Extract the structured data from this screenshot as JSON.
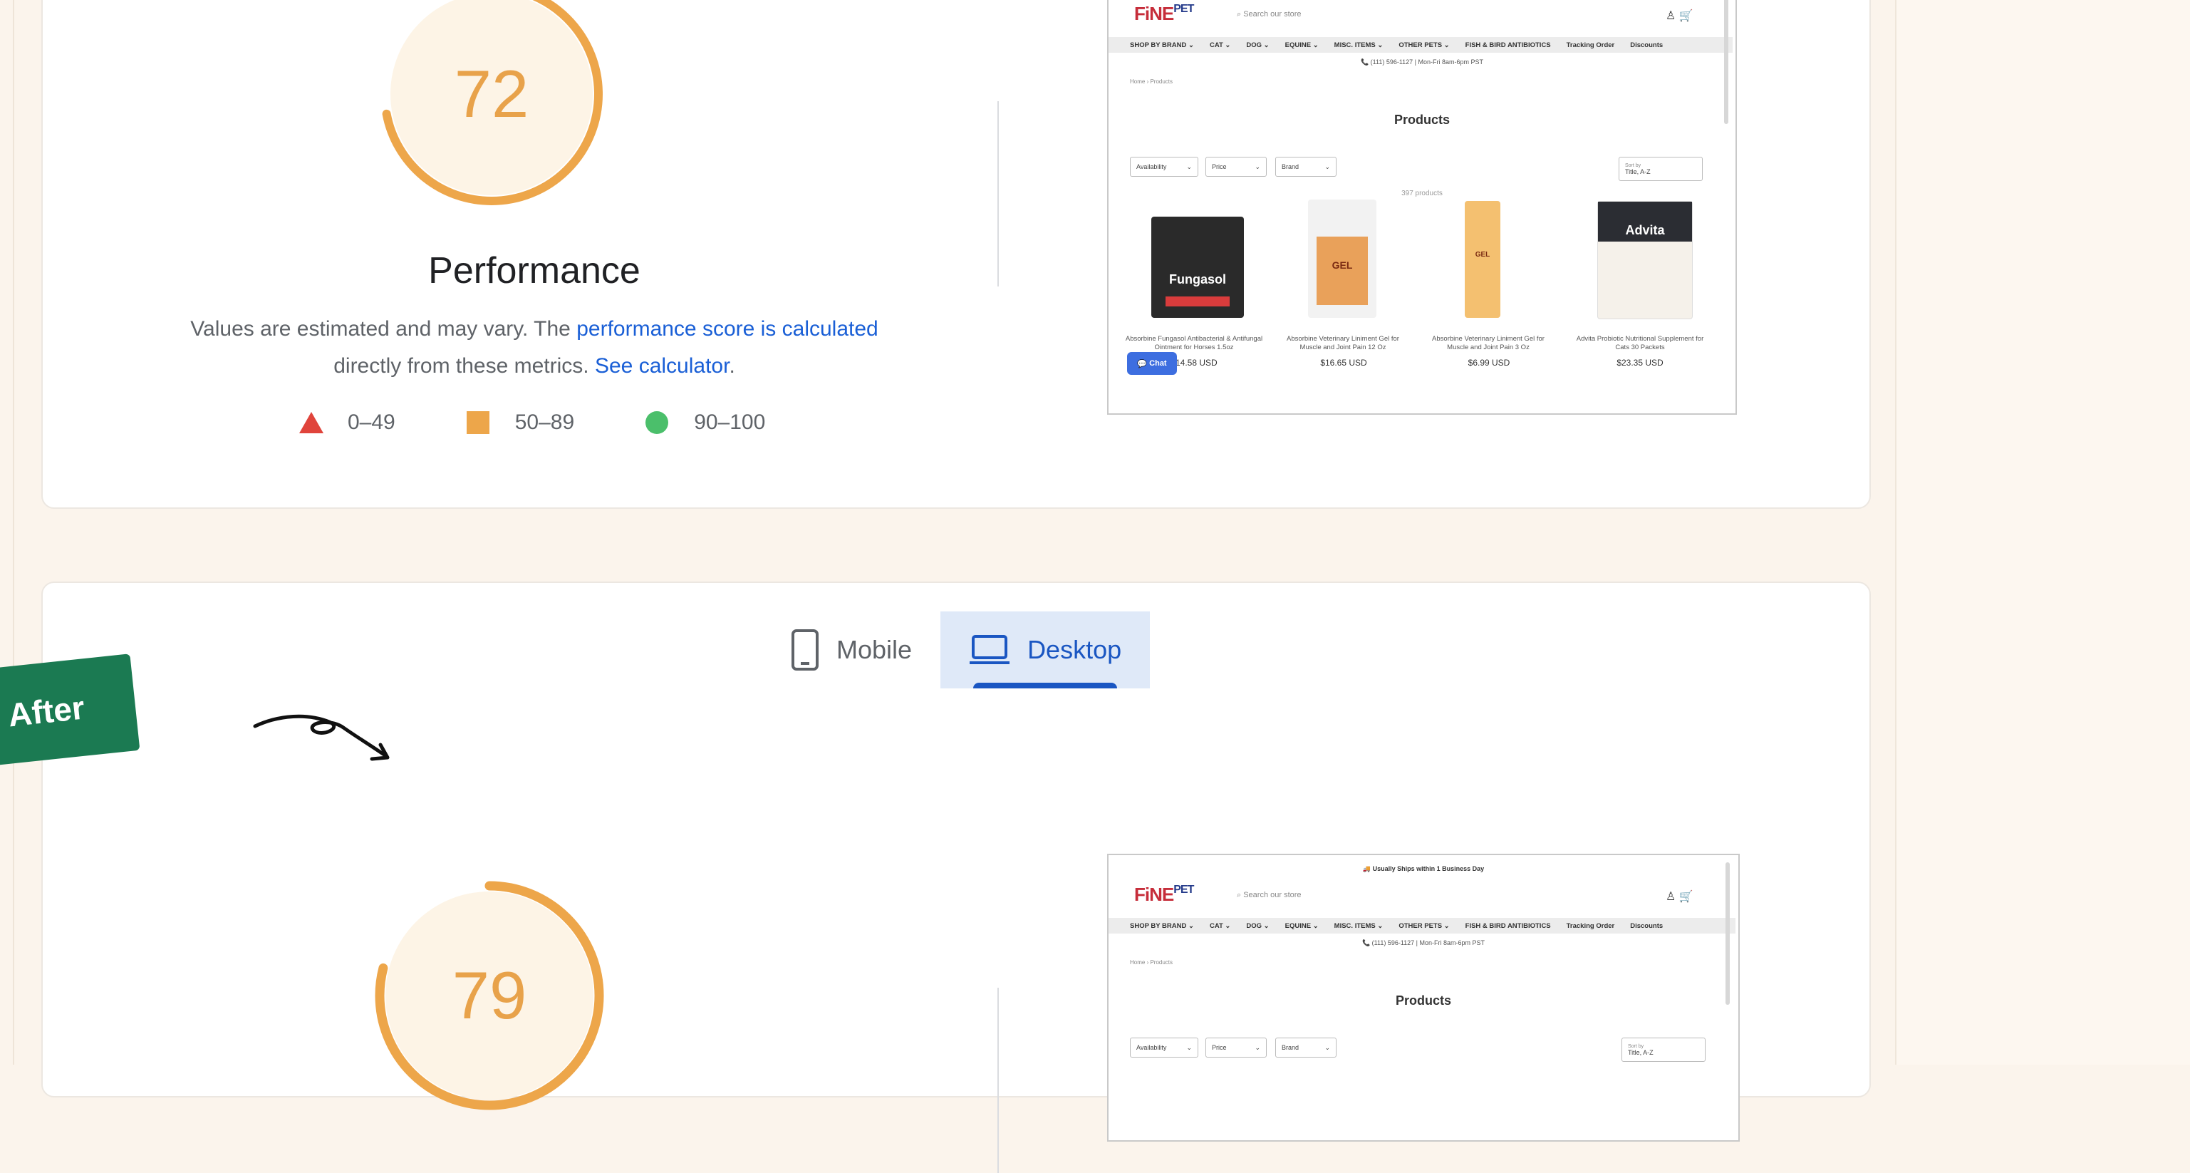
{
  "colors": {
    "accent_orange": "#e8a24a",
    "fail": "#e0443b",
    "average": "#eda64a",
    "pass": "#4bbf6b",
    "link": "#1a5fd6",
    "badge": "#1b7a52"
  },
  "before": {
    "score": "72",
    "score_value": 0.72,
    "title": "Performance",
    "desc_text_1": "Values are estimated and may vary. The ",
    "desc_link_1": "performance score is calculated",
    "desc_text_2": "directly from these metrics. ",
    "desc_link_2": "See calculator",
    "desc_text_3": ".",
    "legend": [
      "0–49",
      "50–89",
      "90–100"
    ]
  },
  "screenshot": {
    "logo": "FiNE",
    "logo_small": "PET",
    "search_placeholder": "Search our store",
    "nav": [
      "SHOP BY BRAND ⌄",
      "CAT ⌄",
      "DOG ⌄",
      "EQUINE ⌄",
      "MISC. ITEMS ⌄",
      "OTHER PETS ⌄",
      "FISH & BIRD ANTIBIOTICS",
      "Tracking Order",
      "Discounts"
    ],
    "phone": "📞 (111) 596-1127 | Mon-Fri 8am-6pm PST",
    "breadcrumb": "Home › Products",
    "heading": "Products",
    "filters": [
      "Availability",
      "Price",
      "Brand"
    ],
    "sort_label": "Sort by",
    "sort_value": "Title, A-Z",
    "count": "397 products",
    "ship_banner": "🚚 Usually Ships within 1 Business Day",
    "chat": "Chat",
    "products": [
      {
        "name": "Absorbine Fungasol Antibacterial & Antifungal Ointment for Horses 1.5oz",
        "price": "$14.58 USD",
        "label": "Fungasol"
      },
      {
        "name": "Absorbine Veterinary Liniment Gel for Muscle and Joint Pain 12 Oz",
        "price": "$16.65 USD",
        "label": "GEL"
      },
      {
        "name": "Absorbine Veterinary Liniment Gel for Muscle and Joint Pain 3 Oz",
        "price": "$6.99 USD",
        "label": "GEL"
      },
      {
        "name": "Advita Probiotic Nutritional Supplement for Cats 30 Packets",
        "price": "$23.35 USD",
        "label": "Advita"
      }
    ]
  },
  "tabs": {
    "mobile": "Mobile",
    "desktop": "Desktop"
  },
  "badge": "After",
  "after": {
    "score": "79",
    "score_value": 0.79
  }
}
